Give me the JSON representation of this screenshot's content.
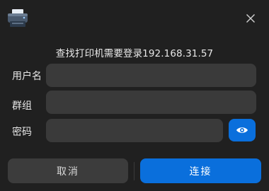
{
  "dialog": {
    "title": "查找打印机需要登录192.168.31.57",
    "icons": {
      "app": "printer-icon",
      "close": "close-icon",
      "toggle_password": "eye-icon"
    }
  },
  "form": {
    "username": {
      "label": "用户名",
      "value": "",
      "placeholder": ""
    },
    "group": {
      "label": "群组",
      "value": "",
      "placeholder": ""
    },
    "password": {
      "label": "密码",
      "value": "",
      "placeholder": ""
    }
  },
  "actions": {
    "cancel_label": "取消",
    "connect_label": "连接"
  },
  "colors": {
    "background": "#202020",
    "input_bg": "#3a3a3a",
    "accent": "#0a6fdc",
    "cancel_bg": "#3c3c3c"
  }
}
